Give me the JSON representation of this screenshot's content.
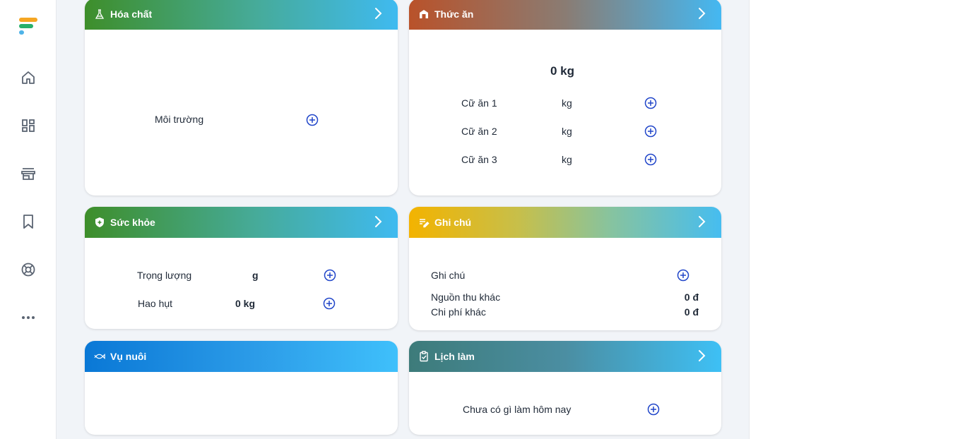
{
  "colors": {
    "accent_blue": "#2045c9",
    "sidebar_icon": "#5b6472"
  },
  "sidebar": {
    "items": [
      {
        "icon": "home-icon"
      },
      {
        "icon": "dashboard-icon"
      },
      {
        "icon": "store-icon"
      },
      {
        "icon": "bookmark-icon"
      },
      {
        "icon": "support-icon"
      },
      {
        "icon": "more-icon"
      }
    ]
  },
  "cards": {
    "chemicals": {
      "title": "Hóa chất",
      "rows": [
        {
          "label": "Môi trường"
        }
      ]
    },
    "feed": {
      "title": "Thức ăn",
      "total": "0 kg",
      "rows": [
        {
          "label": "Cữ ăn 1",
          "unit": "kg"
        },
        {
          "label": "Cữ ăn 2",
          "unit": "kg"
        },
        {
          "label": "Cữ ăn 3",
          "unit": "kg"
        }
      ]
    },
    "health": {
      "title": "Sức khỏe",
      "rows": [
        {
          "label": "Trọng lượng",
          "value": "g"
        },
        {
          "label": "Hao hụt",
          "value": "0 kg"
        }
      ]
    },
    "notes": {
      "title": "Ghi chú",
      "note_label": "Ghi chú",
      "other_income_label": "Nguồn thu khác",
      "other_income_value": "0 đ",
      "other_cost_label": "Chi phí khác",
      "other_cost_value": "0 đ"
    },
    "crop": {
      "title": "Vụ nuôi"
    },
    "schedule": {
      "title": "Lịch làm",
      "empty_text": "Chưa có gì làm hôm nay"
    }
  }
}
